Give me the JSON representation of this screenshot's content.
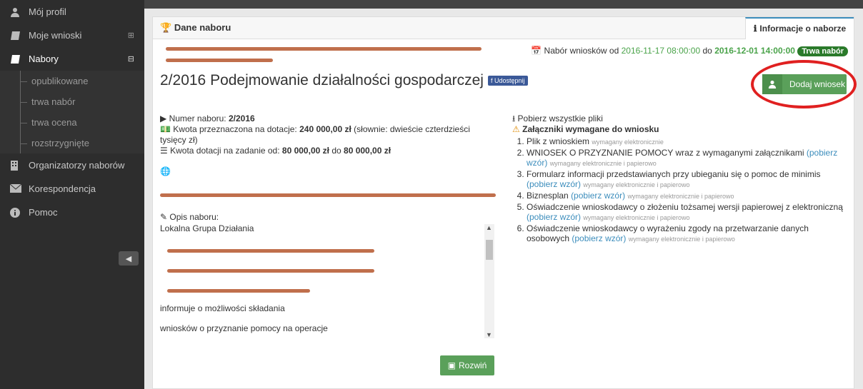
{
  "sidebar": {
    "items": [
      {
        "label": "Mój profil",
        "icon": "user-icon"
      },
      {
        "label": "Moje wnioski",
        "icon": "book-icon",
        "toggle": "⊞"
      },
      {
        "label": "Nabory",
        "icon": "book-icon",
        "toggle": "⊟"
      },
      {
        "label": "Organizatorzy naborów",
        "icon": "building-icon"
      },
      {
        "label": "Korespondencja",
        "icon": "envelope-icon"
      },
      {
        "label": "Pomoc",
        "icon": "info-icon"
      }
    ],
    "sub_items": [
      "opublikowane",
      "trwa nabór",
      "trwa ocena",
      "rozstrzygnięte"
    ]
  },
  "panel": {
    "title": "Dane naboru",
    "tab": "Informacje o naborze",
    "dates_prefix": "Nabór wniosków od",
    "date_from": "2016-11-17 08:00:00",
    "dates_mid": "do",
    "date_to": "2016-12-01 14:00:00",
    "status_badge": "Trwa nabór",
    "heading": "2/2016 Podejmowanie działalności gospodarczej",
    "share_label": "Udostępnij",
    "add_button": "Dodaj wniosek"
  },
  "details": {
    "numer_label": "Numer naboru:",
    "numer_value": "2/2016",
    "kwota_label": "Kwota przeznaczona na dotacje:",
    "kwota_value": "240 000,00 zł",
    "kwota_slownie": "(słownie: dwieście czterdzieści tysięcy zł)",
    "zadanie_label": "Kwota dotacji na zadanie od:",
    "zadanie_from": "80 000,00 zł",
    "zadanie_mid": "do",
    "zadanie_to": "80 000,00 zł",
    "opis_label": "Opis naboru:",
    "opis_lines": [
      "Lokalna Grupa Działania",
      "",
      "",
      "",
      "informuje o możliwości składania",
      "wniosków o przyznanie pomocy na operacje"
    ],
    "expand_button": "Rozwiń"
  },
  "files": {
    "download_all": "Pobierz wszystkie pliki",
    "required_title": "Załączniki wymagane do wniosku",
    "items": [
      {
        "text": "Plik z wnioskiem",
        "link": "",
        "note": "wymagany elektronicznie"
      },
      {
        "text": "WNIOSEK O PRZYZNANIE POMOCY wraz z wymaganymi załącznikami",
        "link": "(pobierz wzór)",
        "note": "wymagany elektronicznie i papierowo"
      },
      {
        "text": "Formularz informacji przedstawianych przy ubieganiu się o pomoc de minimis",
        "link": "(pobierz wzór)",
        "note": "wymagany elektronicznie i papierowo"
      },
      {
        "text": "Biznesplan",
        "link": "(pobierz wzór)",
        "note": "wymagany elektronicznie i papierowo"
      },
      {
        "text": "Oświadczenie wnioskodawcy o złożeniu tożsamej wersji papierowej z elektroniczną",
        "link": "(pobierz wzór)",
        "note": "wymagany elektronicznie i papierowo"
      },
      {
        "text": "Oświadczenie wnioskodawcy o wyrażeniu zgody na przetwarzanie danych osobowych",
        "link": "(pobierz wzór)",
        "note": "wymagany elektronicznie i papierowo"
      }
    ]
  }
}
